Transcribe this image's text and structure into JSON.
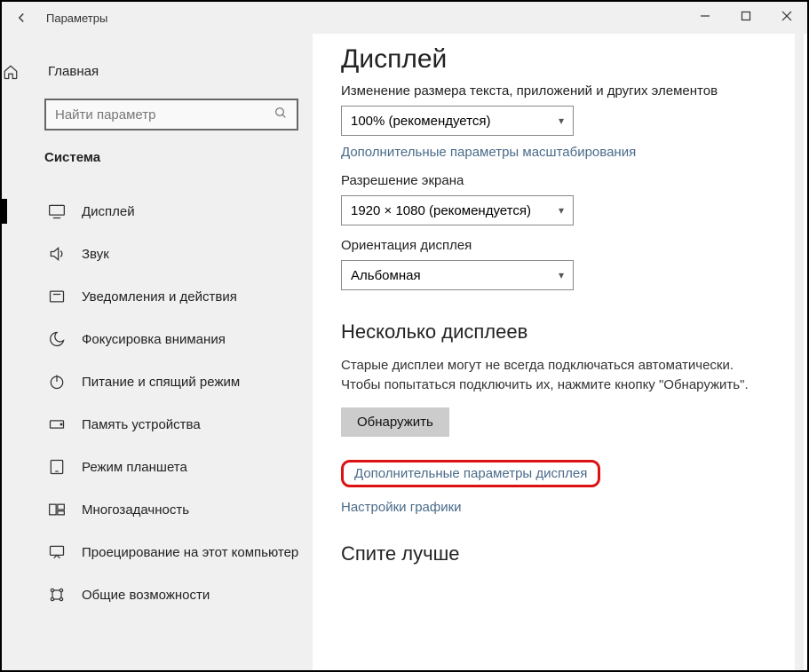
{
  "window": {
    "title": "Параметры"
  },
  "sidebar": {
    "home": "Главная",
    "search_placeholder": "Найти параметр",
    "section": "Система",
    "items": [
      {
        "label": "Дисплей"
      },
      {
        "label": "Звук"
      },
      {
        "label": "Уведомления и действия"
      },
      {
        "label": "Фокусировка внимания"
      },
      {
        "label": "Питание и спящий режим"
      },
      {
        "label": "Память устройства"
      },
      {
        "label": "Режим планшета"
      },
      {
        "label": "Многозадачность"
      },
      {
        "label": "Проецирование на этот компьютер"
      },
      {
        "label": "Общие возможности"
      }
    ]
  },
  "main": {
    "title": "Дисплей",
    "scale_label": "Изменение размера текста, приложений и других элементов",
    "scale_value": "100% (рекомендуется)",
    "scale_advanced": "Дополнительные параметры масштабирования",
    "resolution_label": "Разрешение экрана",
    "resolution_value": "1920 × 1080 (рекомендуется)",
    "orientation_label": "Ориентация дисплея",
    "orientation_value": "Альбомная",
    "multi_title": "Несколько дисплеев",
    "multi_text": "Старые дисплеи могут не всегда подключаться автоматически. Чтобы попытаться подключить их, нажмите кнопку \"Обнаружить\".",
    "detect_btn": "Обнаружить",
    "adv_display_link": "Дополнительные параметры дисплея",
    "graphics_link": "Настройки графики",
    "sleep_title": "Спите лучше"
  }
}
